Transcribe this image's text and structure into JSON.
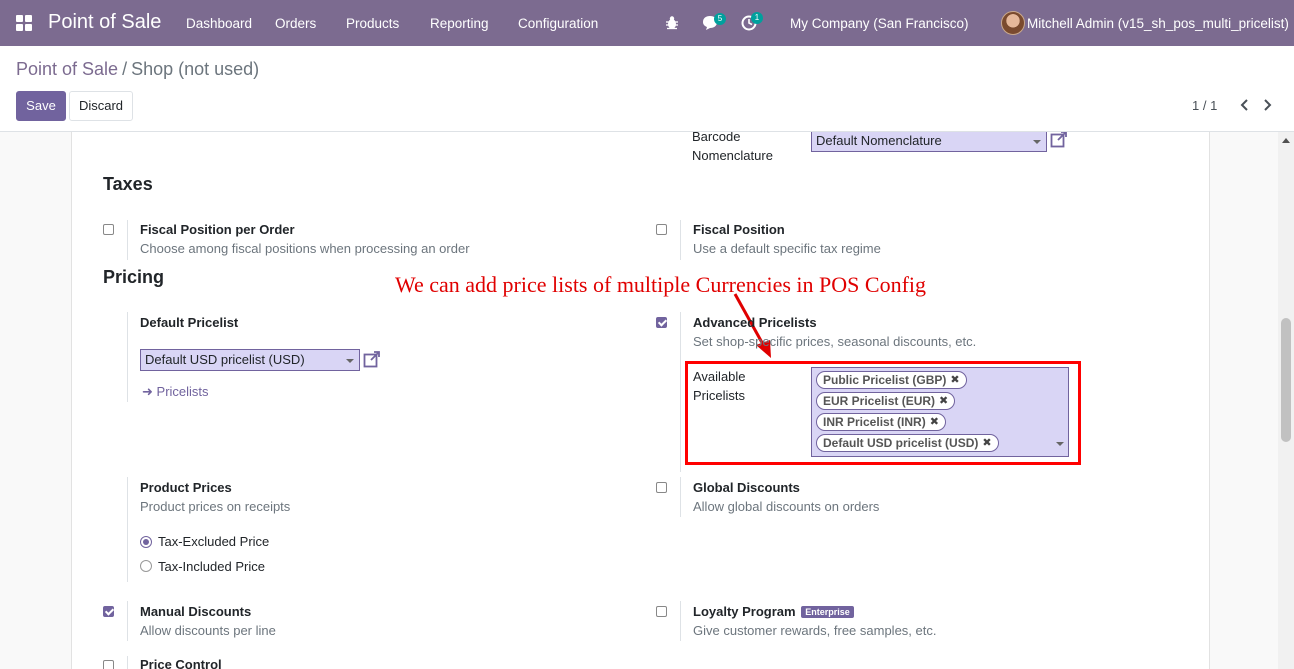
{
  "navbar": {
    "brand": "Point of Sale",
    "menu": [
      "Dashboard",
      "Orders",
      "Products",
      "Reporting",
      "Configuration"
    ],
    "messages_count": "5",
    "activities_count": "1",
    "company": "My Company (San Francisco)",
    "user": "Mitchell Admin (v15_sh_pos_multi_pricelist)"
  },
  "control": {
    "breadcrumb_root": "Point of Sale",
    "breadcrumb_sep": "/",
    "breadcrumb_current": "Shop (not used)",
    "save_label": "Save",
    "discard_label": "Discard",
    "pager": "1 / 1"
  },
  "settings": {
    "barcode": {
      "label_line1": "Barcode",
      "label_line2": "Nomenclature",
      "value": "Default Nomenclature"
    },
    "taxes": {
      "title": "Taxes",
      "fiscal_position_per_order": {
        "title": "Fiscal Position per Order",
        "desc": "Choose among fiscal positions when processing an order",
        "checked": false
      },
      "fiscal_position": {
        "title": "Fiscal Position",
        "desc": "Use a default specific tax regime",
        "checked": false
      }
    },
    "pricing": {
      "title": "Pricing",
      "default_pricelist": {
        "title": "Default Pricelist",
        "value": "Default USD pricelist (USD)",
        "link": "Pricelists"
      },
      "advanced_pricelists": {
        "title": "Advanced Pricelists",
        "desc": "Set shop-specific prices, seasonal discounts, etc.",
        "checked": true,
        "available_label_line1": "Available",
        "available_label_line2": "Pricelists",
        "tags": [
          "Public Pricelist (GBP)",
          "EUR Pricelist (EUR)",
          "INR Pricelist (INR)",
          "Default USD pricelist (USD)"
        ]
      },
      "product_prices": {
        "title": "Product Prices",
        "desc": "Product prices on receipts",
        "options": [
          "Tax-Excluded Price",
          "Tax-Included Price"
        ],
        "selected": "Tax-Excluded Price"
      },
      "global_discounts": {
        "title": "Global Discounts",
        "desc": "Allow global discounts on orders",
        "checked": false
      },
      "manual_discounts": {
        "title": "Manual Discounts",
        "desc": "Allow discounts per line",
        "checked": true
      },
      "loyalty_program": {
        "title": "Loyalty Program",
        "badge": "Enterprise",
        "desc": "Give customer rewards, free samples, etc.",
        "checked": false
      },
      "price_control": {
        "title": "Price Control",
        "checked": false
      }
    }
  },
  "annotation": {
    "text": "We can add price lists of multiple Currencies in POS Config",
    "color": "#e00000"
  },
  "colors": {
    "navbar": "#7c6b90",
    "primary": "#71639e",
    "field_bg": "#d9d5f5",
    "highlight": "#ff0000"
  }
}
